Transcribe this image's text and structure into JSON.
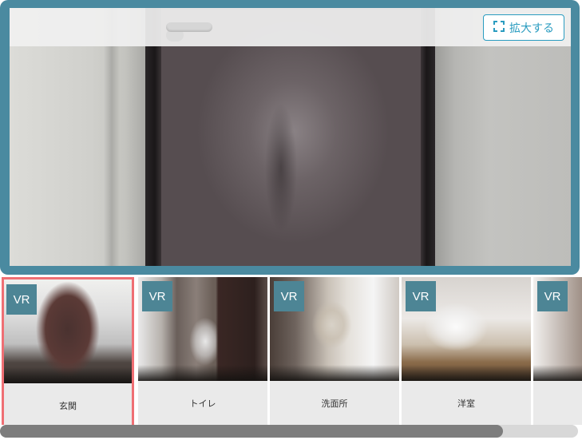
{
  "viewer": {
    "expand_label": "拡大する",
    "expand_icon": "expand-corners-icon"
  },
  "thumbnails": [
    {
      "badge": "VR",
      "label": "玄関",
      "selected": true
    },
    {
      "badge": "VR",
      "label": "トイレ",
      "selected": false
    },
    {
      "badge": "VR",
      "label": "洗面所",
      "selected": false
    },
    {
      "badge": "VR",
      "label": "洋室",
      "selected": false
    },
    {
      "badge": "VR",
      "label": "",
      "selected": false
    }
  ],
  "colors": {
    "frame": "#4a8aa0",
    "accent": "#2a9cc0",
    "selected_border": "#ef6f74",
    "vr_badge": "#4d8595"
  },
  "scrollbar": {
    "visible_fraction": 0.87,
    "position_fraction": 0.0
  }
}
